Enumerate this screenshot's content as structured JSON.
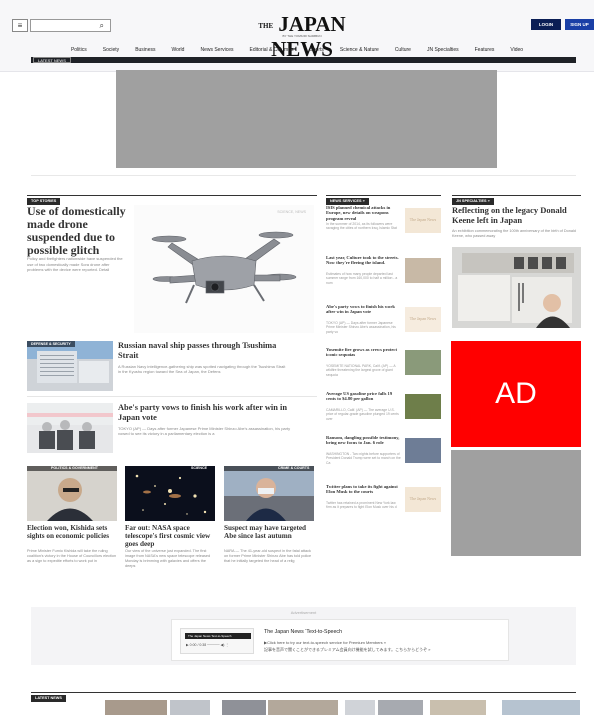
{
  "header": {
    "menu_glyph": "≡",
    "search_glyph": "⌕",
    "logo_the": "THE",
    "logo_main": "JAPAN NEWS",
    "logo_sub": "BY THE YOMIURI SHIMBUN",
    "login": "LOGIN",
    "signup": "SIGN UP"
  },
  "nav": [
    "Politics",
    "Society",
    "Business",
    "World",
    "News Services",
    "Editorial & Columns",
    "Sports",
    "Science & Nature",
    "Culture",
    "JN Specialties",
    "Features",
    "Video"
  ],
  "ticker_label": "LATEST NEWS",
  "sections": {
    "top_stories": "TOP STORIES",
    "news_services": "NEWS SERVICES »",
    "jn_specialties": "JN SPECIALTIES »",
    "latest_news": "LATEST NEWS"
  },
  "lead": {
    "title": "Use of domestically made drone suspended due to possible glitch",
    "desc": "Policy and firefighters nationwide have suspended the use of two domestically made Sora drone after problems with the device were reported. Detail",
    "tag": "SCIENCE, NEWS"
  },
  "stories": [
    {
      "tag": "DEFENSE & SECURITY",
      "title": "Russian naval ship passes through Tsushima Strait",
      "desc": "A Russian Navy intelligence-gathering ship was spotted navigating through the Tsushima Strait in the Kyushu region toward the Sea of Japan, the Defens"
    },
    {
      "tag": "",
      "title": "Abe's party vows to finish his work after win in Japan vote",
      "desc": "TOKYO (AP) — Days after former Japanese Prime Minister Shinzo Abe's assassination, his party vowed to see its victory in a parliamentary election is a"
    }
  ],
  "cards": [
    {
      "tag": "POLITICS & GOVERNMENT",
      "title": "Election won, Kishida sets sights on economic policies",
      "desc": "Prime Minister Fumio Kishida will take the ruling coalition's victory in the House of Councillors election as a sign to expedite efforts to work put in"
    },
    {
      "tag": "SCIENCE",
      "title": "Far out: NASA space telescope's first cosmic view goes deep",
      "desc": "Our view of the universe just expanded. The first image from NASA's new space telescope released Monday is brimming with galaxies and offers the deeps"
    },
    {
      "tag": "CRIME & COURTS",
      "title": "Suspect may have targeted Abe since last autumn",
      "desc": "NARA — The 41-year-old suspect in the fatal attack on former Prime Minister Shinzo Abe has told police that he initially targeted the head of a relig"
    }
  ],
  "news_services": [
    {
      "title": "ISIS planned chemical attacks in Europe, new details on weapons program reveal",
      "desc": "In the summer of 2014, as its followers were ravaging the cities of northern Iraq, Islamic Stat"
    },
    {
      "title": "Last year, Culture took to the streets. Now they're fleeing the island.",
      "desc": "Estimates of how many people departed last summer range from 160,000 to half a million - a num"
    },
    {
      "title": "Abe's party vows to finish his work after win in Japan vote",
      "desc": "TOKYO (AP) — Days after former Japanese Prime Minister Shinzo Abe's assassination, his party vo"
    },
    {
      "title": "Yosemite fire grows as crews protect iconic sequoias",
      "desc": "YOSEMITE NATIONAL PARK, Calif. (AP) — A wildfire threatening the largest grove of giant sequoia"
    },
    {
      "title": "Average US gasoline price falls 19 cents to $4.80 per gallon",
      "desc": "CAMARILLO, Calif. (AP) — The average U.S. price of regular-grade gasoline plunged 19 cents over"
    },
    {
      "title": "Ransom, dangling possible testimony, bring new focus to Jan. 6 role",
      "desc": "WASHINGTON - Two nights before supporters of President Donald Trump were set to march on the Ca"
    },
    {
      "title": "Twitter plans to take its fight against Elon Musk to the courts",
      "desc": "Twitter has retained a prominent New York law firm as it prepares to fight Elon Musk over his d"
    }
  ],
  "ns_thumb_text": "The Japan News",
  "jn": {
    "title": "Reflecting on the legacy Donald Keene left in Japan",
    "desc": "An exhibition commemorating the 100th anniversary of the birth of Donald Keene, who passed away"
  },
  "ad_label": "AD",
  "promo": {
    "advertisement": "Advertisement",
    "player_label": "The Japan News Text-to-Speech",
    "player_ctrl": "▶  0:00 / 0:38  ─────  ◀)  ⋮",
    "title": "The Japan News ‘Text-to-Speech",
    "line1": "▶Click here to try our text-to-speech service for Premium Members »",
    "line2": "記事を音声で聞くことができるプレミアム会員向け機能を試してみます。こちらからどうぞ »"
  },
  "colors": {
    "brand_dark": "#0b1e55",
    "brand_blue": "#1a3fa6",
    "ad_red": "#ff0000",
    "ad_gray": "#a0a0a0"
  }
}
